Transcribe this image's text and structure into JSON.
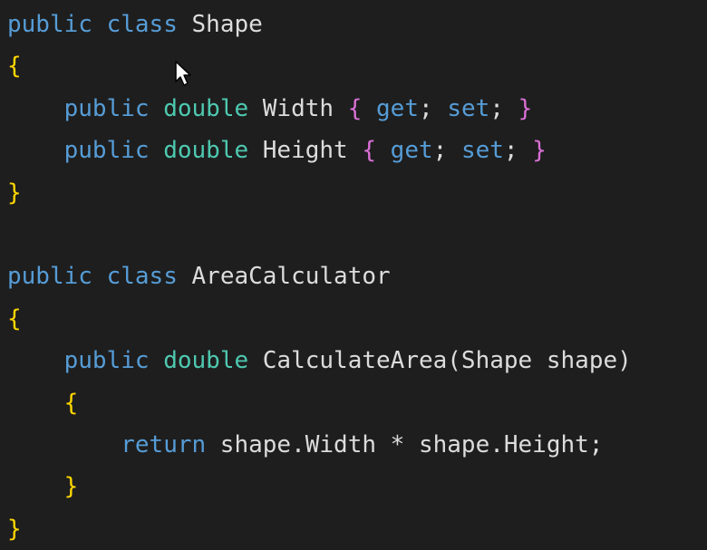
{
  "colors": {
    "background": "#1e1e1e",
    "keyword": "#569cd6",
    "type": "#4ec9b0",
    "identifier": "#dcdcdc",
    "brace_outer": "#ffd700",
    "brace_inner": "#da70d6"
  },
  "code": {
    "lines": [
      {
        "indent": "",
        "tokens": [
          {
            "t": "kw",
            "v": "public"
          },
          {
            "t": "pu",
            "v": " "
          },
          {
            "t": "kw",
            "v": "class"
          },
          {
            "t": "pu",
            "v": " "
          },
          {
            "t": "id",
            "v": "Shape"
          }
        ]
      },
      {
        "indent": "",
        "tokens": [
          {
            "t": "br",
            "v": "{"
          }
        ]
      },
      {
        "indent": "    ",
        "tokens": [
          {
            "t": "kw",
            "v": "public"
          },
          {
            "t": "pu",
            "v": " "
          },
          {
            "t": "ty",
            "v": "double"
          },
          {
            "t": "pu",
            "v": " "
          },
          {
            "t": "id",
            "v": "Width"
          },
          {
            "t": "pu",
            "v": " "
          },
          {
            "t": "br2",
            "v": "{"
          },
          {
            "t": "pu",
            "v": " "
          },
          {
            "t": "kw",
            "v": "get"
          },
          {
            "t": "pu",
            "v": "; "
          },
          {
            "t": "kw",
            "v": "set"
          },
          {
            "t": "pu",
            "v": "; "
          },
          {
            "t": "br2",
            "v": "}"
          }
        ]
      },
      {
        "indent": "    ",
        "tokens": [
          {
            "t": "kw",
            "v": "public"
          },
          {
            "t": "pu",
            "v": " "
          },
          {
            "t": "ty",
            "v": "double"
          },
          {
            "t": "pu",
            "v": " "
          },
          {
            "t": "id",
            "v": "Height"
          },
          {
            "t": "pu",
            "v": " "
          },
          {
            "t": "br2",
            "v": "{"
          },
          {
            "t": "pu",
            "v": " "
          },
          {
            "t": "kw",
            "v": "get"
          },
          {
            "t": "pu",
            "v": "; "
          },
          {
            "t": "kw",
            "v": "set"
          },
          {
            "t": "pu",
            "v": "; "
          },
          {
            "t": "br2",
            "v": "}"
          }
        ]
      },
      {
        "indent": "",
        "tokens": [
          {
            "t": "br",
            "v": "}"
          }
        ]
      },
      {
        "indent": "",
        "tokens": []
      },
      {
        "indent": "",
        "tokens": [
          {
            "t": "kw",
            "v": "public"
          },
          {
            "t": "pu",
            "v": " "
          },
          {
            "t": "kw",
            "v": "class"
          },
          {
            "t": "pu",
            "v": " "
          },
          {
            "t": "id",
            "v": "AreaCalculator"
          }
        ]
      },
      {
        "indent": "",
        "tokens": [
          {
            "t": "br",
            "v": "{"
          }
        ]
      },
      {
        "indent": "    ",
        "tokens": [
          {
            "t": "kw",
            "v": "public"
          },
          {
            "t": "pu",
            "v": " "
          },
          {
            "t": "ty",
            "v": "double"
          },
          {
            "t": "pu",
            "v": " "
          },
          {
            "t": "id",
            "v": "CalculateArea"
          },
          {
            "t": "pu",
            "v": "(Shape shape)"
          }
        ]
      },
      {
        "indent": "    ",
        "tokens": [
          {
            "t": "br",
            "v": "{"
          }
        ]
      },
      {
        "indent": "        ",
        "tokens": [
          {
            "t": "kw",
            "v": "return"
          },
          {
            "t": "pu",
            "v": " shape.Width * shape.Height;"
          }
        ]
      },
      {
        "indent": "    ",
        "tokens": [
          {
            "t": "br",
            "v": "}"
          }
        ]
      },
      {
        "indent": "",
        "tokens": [
          {
            "t": "br",
            "v": "}"
          }
        ]
      }
    ]
  },
  "cursor_icon": "mouse-pointer-icon"
}
